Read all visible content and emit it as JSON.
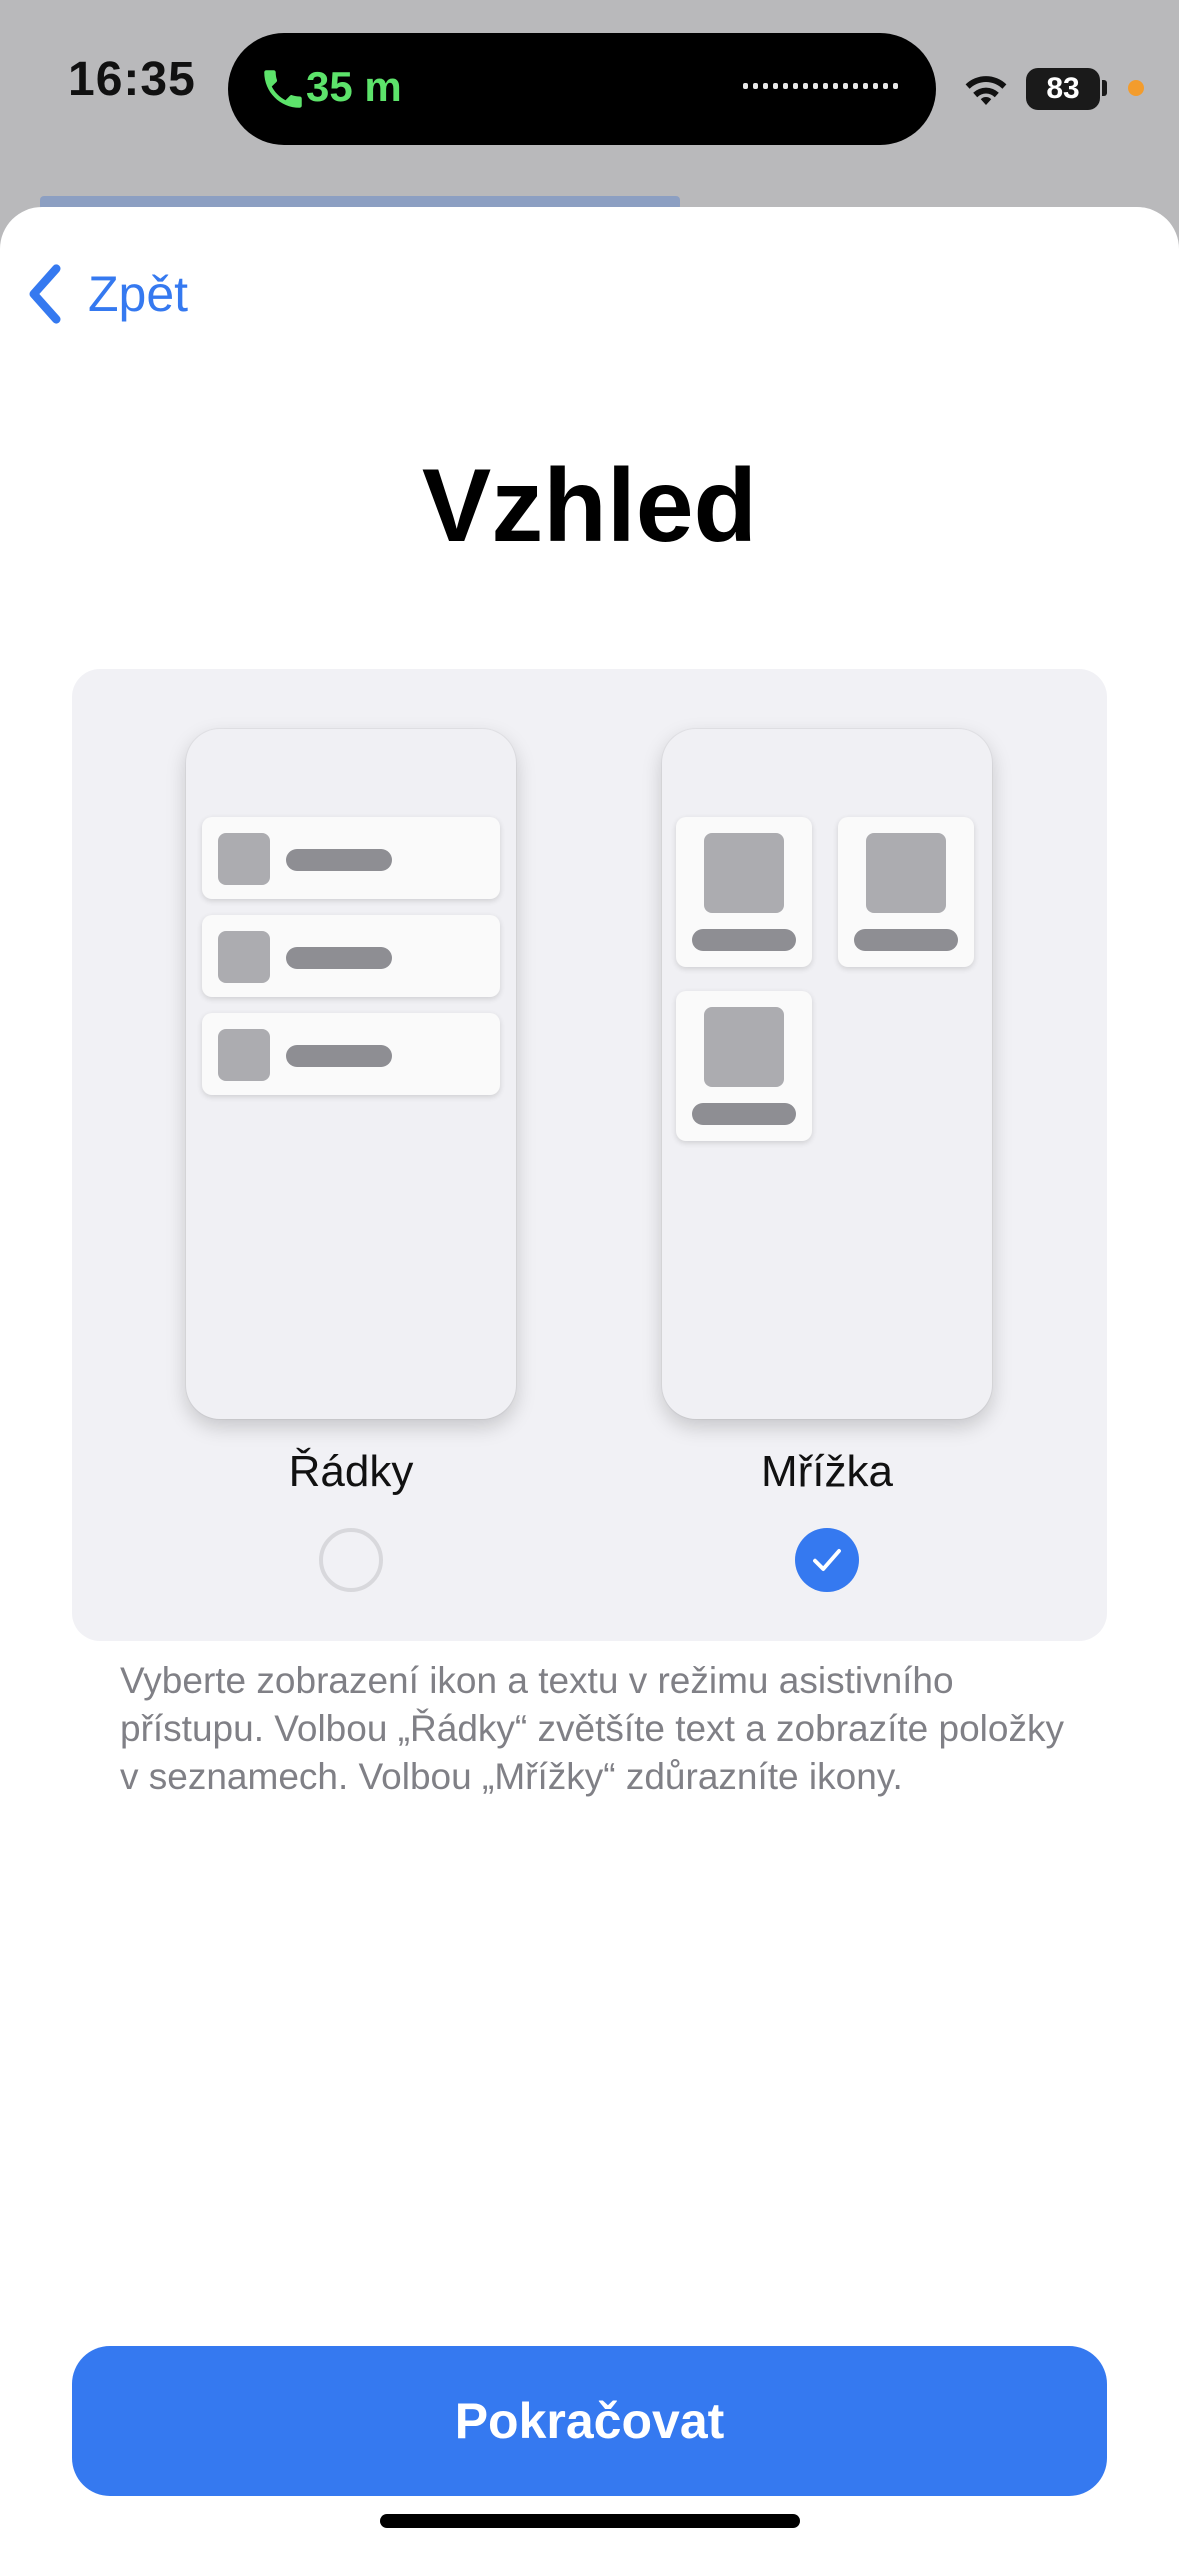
{
  "status_bar": {
    "time": "16:35",
    "call_duration": "35 m",
    "battery_level": "83",
    "icons": {
      "call": "phone-icon",
      "wifi": "wifi-icon",
      "battery": "battery-icon"
    },
    "colors": {
      "call_green": "#5de36b",
      "privacy_dot": "#f39c2c"
    }
  },
  "nav": {
    "back_label": "Zpět",
    "back_icon": "chevron-left-icon"
  },
  "page": {
    "title": "Vzhled"
  },
  "options": [
    {
      "label": "Řádky",
      "selected": false,
      "preview": "rows"
    },
    {
      "label": "Mřížka",
      "selected": true,
      "preview": "grid"
    }
  ],
  "description": "Vyberte zobrazení ikon a textu v režimu asistivního přístupu. Volbou „Řádky“ zvětšíte text a zobrazíte položky v seznamech. Volbou „Mřížky“ zdůrazníte ikony.",
  "footer": {
    "continue_label": "Pokračovat"
  },
  "colors": {
    "accent": "#3579f0",
    "card_background": "#f1f1f5",
    "description_text": "#808086"
  }
}
